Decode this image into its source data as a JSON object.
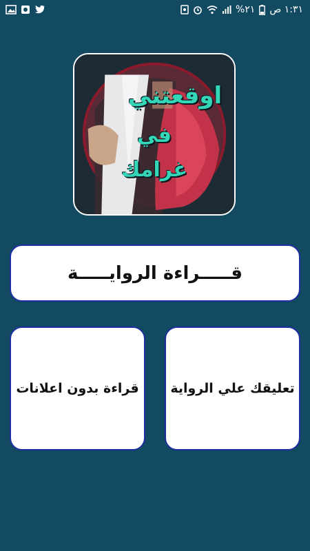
{
  "status_bar": {
    "time": "١:٣١ ص",
    "battery": "%٢١",
    "icons": [
      "wifi-icon",
      "signal-icon",
      "alarm-icon",
      "app-notification-icon",
      "twitter-icon",
      "notification-icon",
      "image-icon"
    ]
  },
  "cover": {
    "line1": "اوقعتني",
    "line2": "في",
    "line3": "غرامك"
  },
  "buttons": {
    "read": "قـــــراءة الروايـــــة",
    "comment": "تعليقك علي الرواية",
    "no_ads": "قراءة بدون اعلانات"
  },
  "colors": {
    "background": "#124a61",
    "button_border": "#1d2fa0",
    "title_color": "#34d6b8"
  }
}
